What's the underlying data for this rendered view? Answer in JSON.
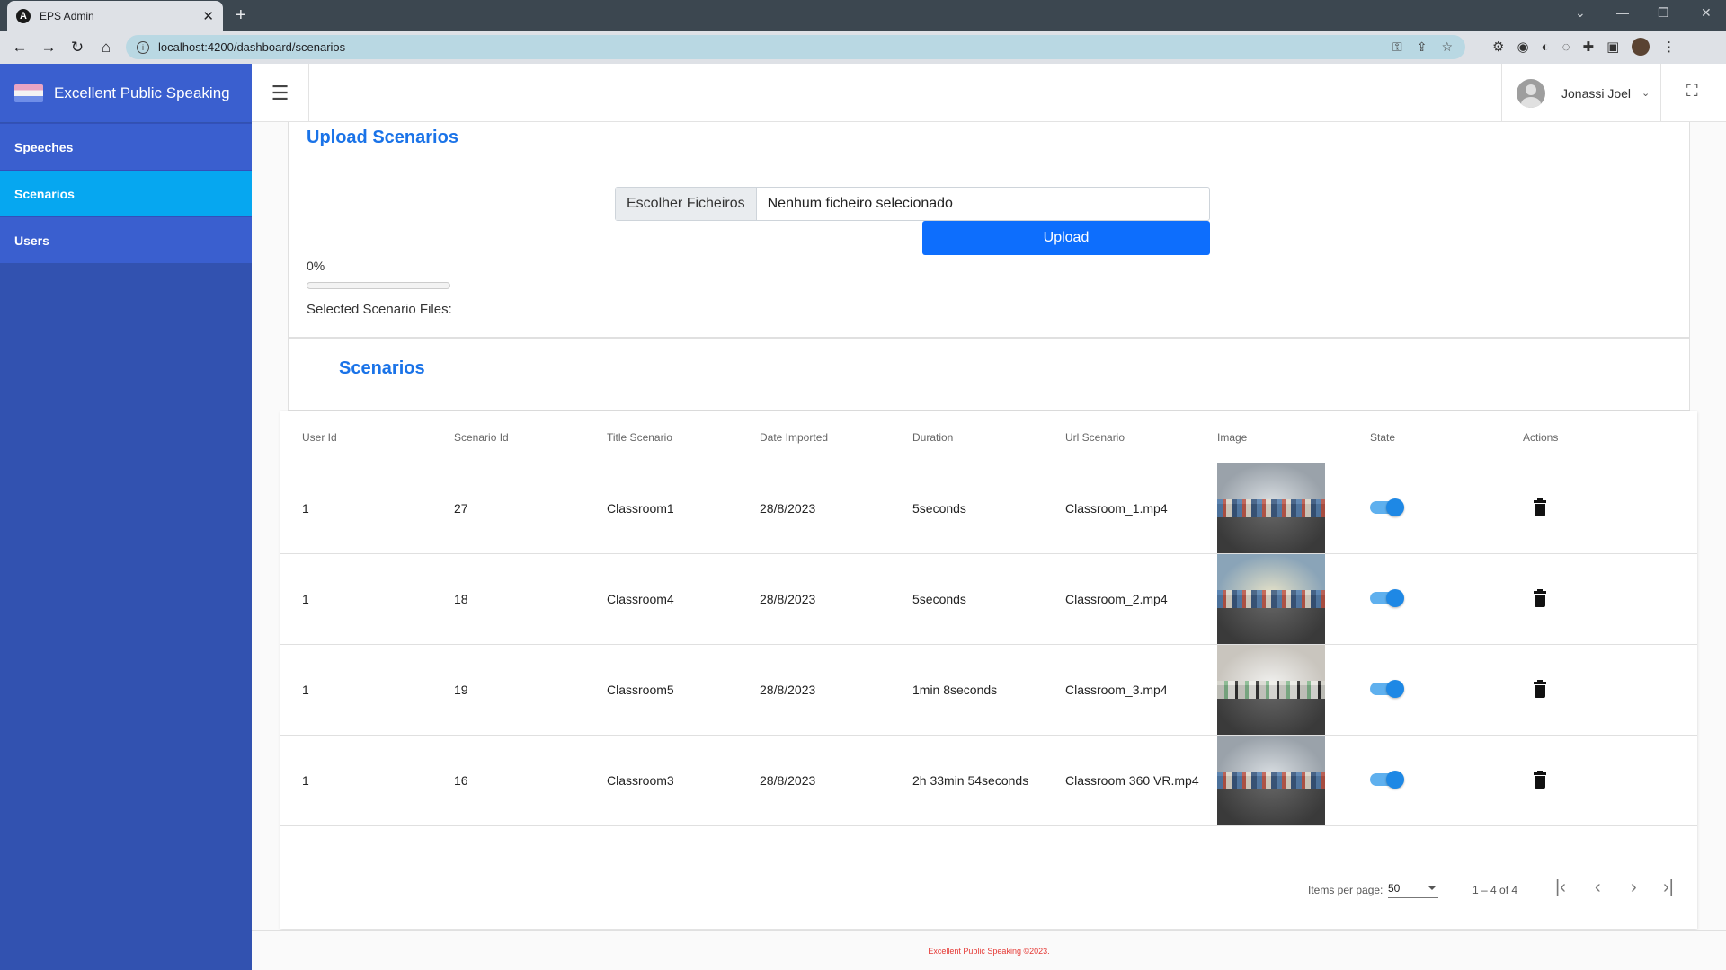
{
  "browser": {
    "tab_title": "EPS Admin",
    "url": "localhost:4200/dashboard/scenarios"
  },
  "sidebar": {
    "brand": "Excellent Public Speaking",
    "items": [
      {
        "label": "Speeches"
      },
      {
        "label": "Scenarios"
      },
      {
        "label": "Users"
      }
    ]
  },
  "header": {
    "user_name": "Jonassi Joel"
  },
  "upload": {
    "title": "Upload Scenarios",
    "file_button": "Escolher Ficheiros",
    "file_status": "Nenhum ficheiro selecionado",
    "upload_button": "Upload",
    "progress_text": "0%",
    "progress_value": 0,
    "selected_label": "Selected Scenario Files:"
  },
  "scenarios": {
    "title": "Scenarios",
    "columns": [
      "User Id",
      "Scenario Id",
      "Title Scenario",
      "Date Imported",
      "Duration",
      "Url Scenario",
      "Image",
      "State",
      "Actions"
    ],
    "rows": [
      {
        "user_id": "1",
        "scenario_id": "27",
        "title": "Classroom1",
        "date": "28/8/2023",
        "duration": "5seconds",
        "url": "Classroom_1.mp4",
        "state": true
      },
      {
        "user_id": "1",
        "scenario_id": "18",
        "title": "Classroom4",
        "date": "28/8/2023",
        "duration": "5seconds",
        "url": "Classroom_2.mp4",
        "state": true
      },
      {
        "user_id": "1",
        "scenario_id": "19",
        "title": "Classroom5",
        "date": "28/8/2023",
        "duration": "1min 8seconds",
        "url": "Classroom_3.mp4",
        "state": true
      },
      {
        "user_id": "1",
        "scenario_id": "16",
        "title": "Classroom3",
        "date": "28/8/2023",
        "duration": "2h 33min 54seconds",
        "url": "Classroom 360 VR.mp4",
        "state": true
      }
    ]
  },
  "paginator": {
    "items_per_page_label": "Items per page:",
    "page_size": "50",
    "range": "1 – 4 of 4"
  },
  "footer": {
    "text": "Excellent Public Speaking ©2023."
  },
  "colors": {
    "sidebar": "#3252b0",
    "active_item": "#06a7f0",
    "accent": "#1a73e8",
    "upload_button": "#0d6efd"
  }
}
